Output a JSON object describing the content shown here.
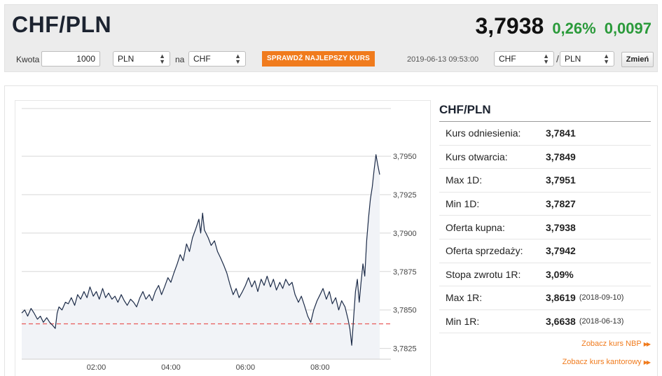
{
  "header": {
    "pair": "CHF/PLN",
    "price": "3,7938",
    "change_pct": "0,26%",
    "change_abs": "0,0097"
  },
  "controls": {
    "amount_label": "Kwota",
    "amount_value": "1000",
    "from_currency": "PLN",
    "to_label": "na",
    "to_currency": "CHF",
    "best_rate_button": "SPRAWDŹ NAJLEPSZY KURS",
    "timestamp": "2019-06-13 09:53:00",
    "base_currency": "CHF",
    "slash": "/",
    "quote_currency": "PLN",
    "change_button": "Zmień"
  },
  "sidebar": {
    "title": "CHF/PLN",
    "rows": [
      {
        "label": "Kurs odniesienia:",
        "value": "3,7841",
        "date": ""
      },
      {
        "label": "Kurs otwarcia:",
        "value": "3,7849",
        "date": ""
      },
      {
        "label": "Max 1D:",
        "value": "3,7951",
        "date": ""
      },
      {
        "label": "Min 1D:",
        "value": "3,7827",
        "date": ""
      },
      {
        "label": "Oferta kupna:",
        "value": "3,7938",
        "date": ""
      },
      {
        "label": "Oferta sprzedaży:",
        "value": "3,7942",
        "date": ""
      },
      {
        "label": "Stopa zwrotu 1R:",
        "value": "3,09%",
        "date": ""
      },
      {
        "label": "Max 1R:",
        "value": "3,8619",
        "date": "(2018-09-10)"
      },
      {
        "label": "Min 1R:",
        "value": "3,6638",
        "date": "(2018-06-13)"
      }
    ],
    "link_nbp": "Zobacz kurs NBP",
    "link_exchange": "Zobacz kurs kantorowy"
  },
  "chart_data": {
    "type": "line",
    "x_ticks": [
      "02:00",
      "04:00",
      "06:00",
      "08:00"
    ],
    "x_tick_hours": [
      2,
      4,
      6,
      8
    ],
    "xlim_hours": [
      0,
      9.9
    ],
    "y_ticks": [
      "3,7950",
      "3,7925",
      "3,7900",
      "3,7875",
      "3,7850",
      "3,7825"
    ],
    "y_tick_values": [
      3.795,
      3.7925,
      3.79,
      3.7875,
      3.785,
      3.7825
    ],
    "ylim": [
      3.7818,
      3.7981
    ],
    "reference_value": 3.7841,
    "colors": {
      "line": "#1c2b48",
      "fill": "#f1f3f7",
      "reference": "#e85a5a",
      "grid": "#d7d7d7"
    },
    "series": [
      {
        "points": [
          [
            0.0,
            3.7848
          ],
          [
            0.08,
            3.785
          ],
          [
            0.16,
            3.7846
          ],
          [
            0.25,
            3.7851
          ],
          [
            0.33,
            3.7848
          ],
          [
            0.42,
            3.7844
          ],
          [
            0.5,
            3.7846
          ],
          [
            0.58,
            3.7842
          ],
          [
            0.67,
            3.7845
          ],
          [
            0.75,
            3.7842
          ],
          [
            0.83,
            3.784
          ],
          [
            0.9,
            3.7838
          ],
          [
            0.95,
            3.7848
          ],
          [
            1.0,
            3.7852
          ],
          [
            1.08,
            3.785
          ],
          [
            1.17,
            3.7855
          ],
          [
            1.25,
            3.7854
          ],
          [
            1.33,
            3.7858
          ],
          [
            1.42,
            3.7853
          ],
          [
            1.5,
            3.786
          ],
          [
            1.58,
            3.7857
          ],
          [
            1.67,
            3.7862
          ],
          [
            1.75,
            3.7858
          ],
          [
            1.83,
            3.7865
          ],
          [
            1.92,
            3.7859
          ],
          [
            2.0,
            3.7862
          ],
          [
            2.08,
            3.7857
          ],
          [
            2.17,
            3.7864
          ],
          [
            2.25,
            3.7858
          ],
          [
            2.33,
            3.7861
          ],
          [
            2.42,
            3.7857
          ],
          [
            2.5,
            3.7859
          ],
          [
            2.58,
            3.7855
          ],
          [
            2.67,
            3.786
          ],
          [
            2.75,
            3.7856
          ],
          [
            2.83,
            3.7853
          ],
          [
            2.92,
            3.7857
          ],
          [
            3.0,
            3.7855
          ],
          [
            3.08,
            3.7852
          ],
          [
            3.17,
            3.7858
          ],
          [
            3.25,
            3.7862
          ],
          [
            3.33,
            3.7857
          ],
          [
            3.42,
            3.786
          ],
          [
            3.5,
            3.7856
          ],
          [
            3.58,
            3.7862
          ],
          [
            3.67,
            3.7866
          ],
          [
            3.75,
            3.786
          ],
          [
            3.83,
            3.7865
          ],
          [
            3.92,
            3.7871
          ],
          [
            4.0,
            3.7868
          ],
          [
            4.08,
            3.7874
          ],
          [
            4.17,
            3.788
          ],
          [
            4.25,
            3.7886
          ],
          [
            4.33,
            3.7882
          ],
          [
            4.42,
            3.7893
          ],
          [
            4.5,
            3.7888
          ],
          [
            4.58,
            3.7897
          ],
          [
            4.67,
            3.7903
          ],
          [
            4.75,
            3.7909
          ],
          [
            4.8,
            3.79
          ],
          [
            4.85,
            3.7913
          ],
          [
            4.9,
            3.7902
          ],
          [
            5.0,
            3.7897
          ],
          [
            5.08,
            3.7892
          ],
          [
            5.17,
            3.7895
          ],
          [
            5.25,
            3.7888
          ],
          [
            5.33,
            3.7884
          ],
          [
            5.42,
            3.7879
          ],
          [
            5.5,
            3.7874
          ],
          [
            5.58,
            3.7867
          ],
          [
            5.67,
            3.786
          ],
          [
            5.75,
            3.7864
          ],
          [
            5.83,
            3.7858
          ],
          [
            5.92,
            3.7862
          ],
          [
            6.0,
            3.7866
          ],
          [
            6.08,
            3.7871
          ],
          [
            6.17,
            3.7865
          ],
          [
            6.25,
            3.7869
          ],
          [
            6.33,
            3.7862
          ],
          [
            6.42,
            3.787
          ],
          [
            6.5,
            3.7866
          ],
          [
            6.58,
            3.7872
          ],
          [
            6.67,
            3.7865
          ],
          [
            6.75,
            3.787
          ],
          [
            6.83,
            3.7863
          ],
          [
            6.92,
            3.7868
          ],
          [
            7.0,
            3.7864
          ],
          [
            7.08,
            3.787
          ],
          [
            7.17,
            3.7866
          ],
          [
            7.25,
            3.7868
          ],
          [
            7.33,
            3.786
          ],
          [
            7.42,
            3.7855
          ],
          [
            7.5,
            3.7859
          ],
          [
            7.58,
            3.7853
          ],
          [
            7.67,
            3.7846
          ],
          [
            7.75,
            3.7842
          ],
          [
            7.83,
            3.785
          ],
          [
            7.92,
            3.7856
          ],
          [
            8.0,
            3.786
          ],
          [
            8.08,
            3.7864
          ],
          [
            8.17,
            3.7857
          ],
          [
            8.25,
            3.7862
          ],
          [
            8.33,
            3.7854
          ],
          [
            8.42,
            3.7858
          ],
          [
            8.5,
            3.785
          ],
          [
            8.58,
            3.7856
          ],
          [
            8.67,
            3.7852
          ],
          [
            8.75,
            3.7844
          ],
          [
            8.8,
            3.7838
          ],
          [
            8.85,
            3.7827
          ],
          [
            8.9,
            3.7845
          ],
          [
            8.95,
            3.7862
          ],
          [
            9.0,
            3.787
          ],
          [
            9.05,
            3.7855
          ],
          [
            9.1,
            3.7868
          ],
          [
            9.15,
            3.788
          ],
          [
            9.2,
            3.7872
          ],
          [
            9.25,
            3.7895
          ],
          [
            9.3,
            3.791
          ],
          [
            9.35,
            3.7922
          ],
          [
            9.4,
            3.793
          ],
          [
            9.45,
            3.7941
          ],
          [
            9.5,
            3.7951
          ],
          [
            9.55,
            3.7944
          ],
          [
            9.6,
            3.7938
          ]
        ]
      }
    ]
  }
}
